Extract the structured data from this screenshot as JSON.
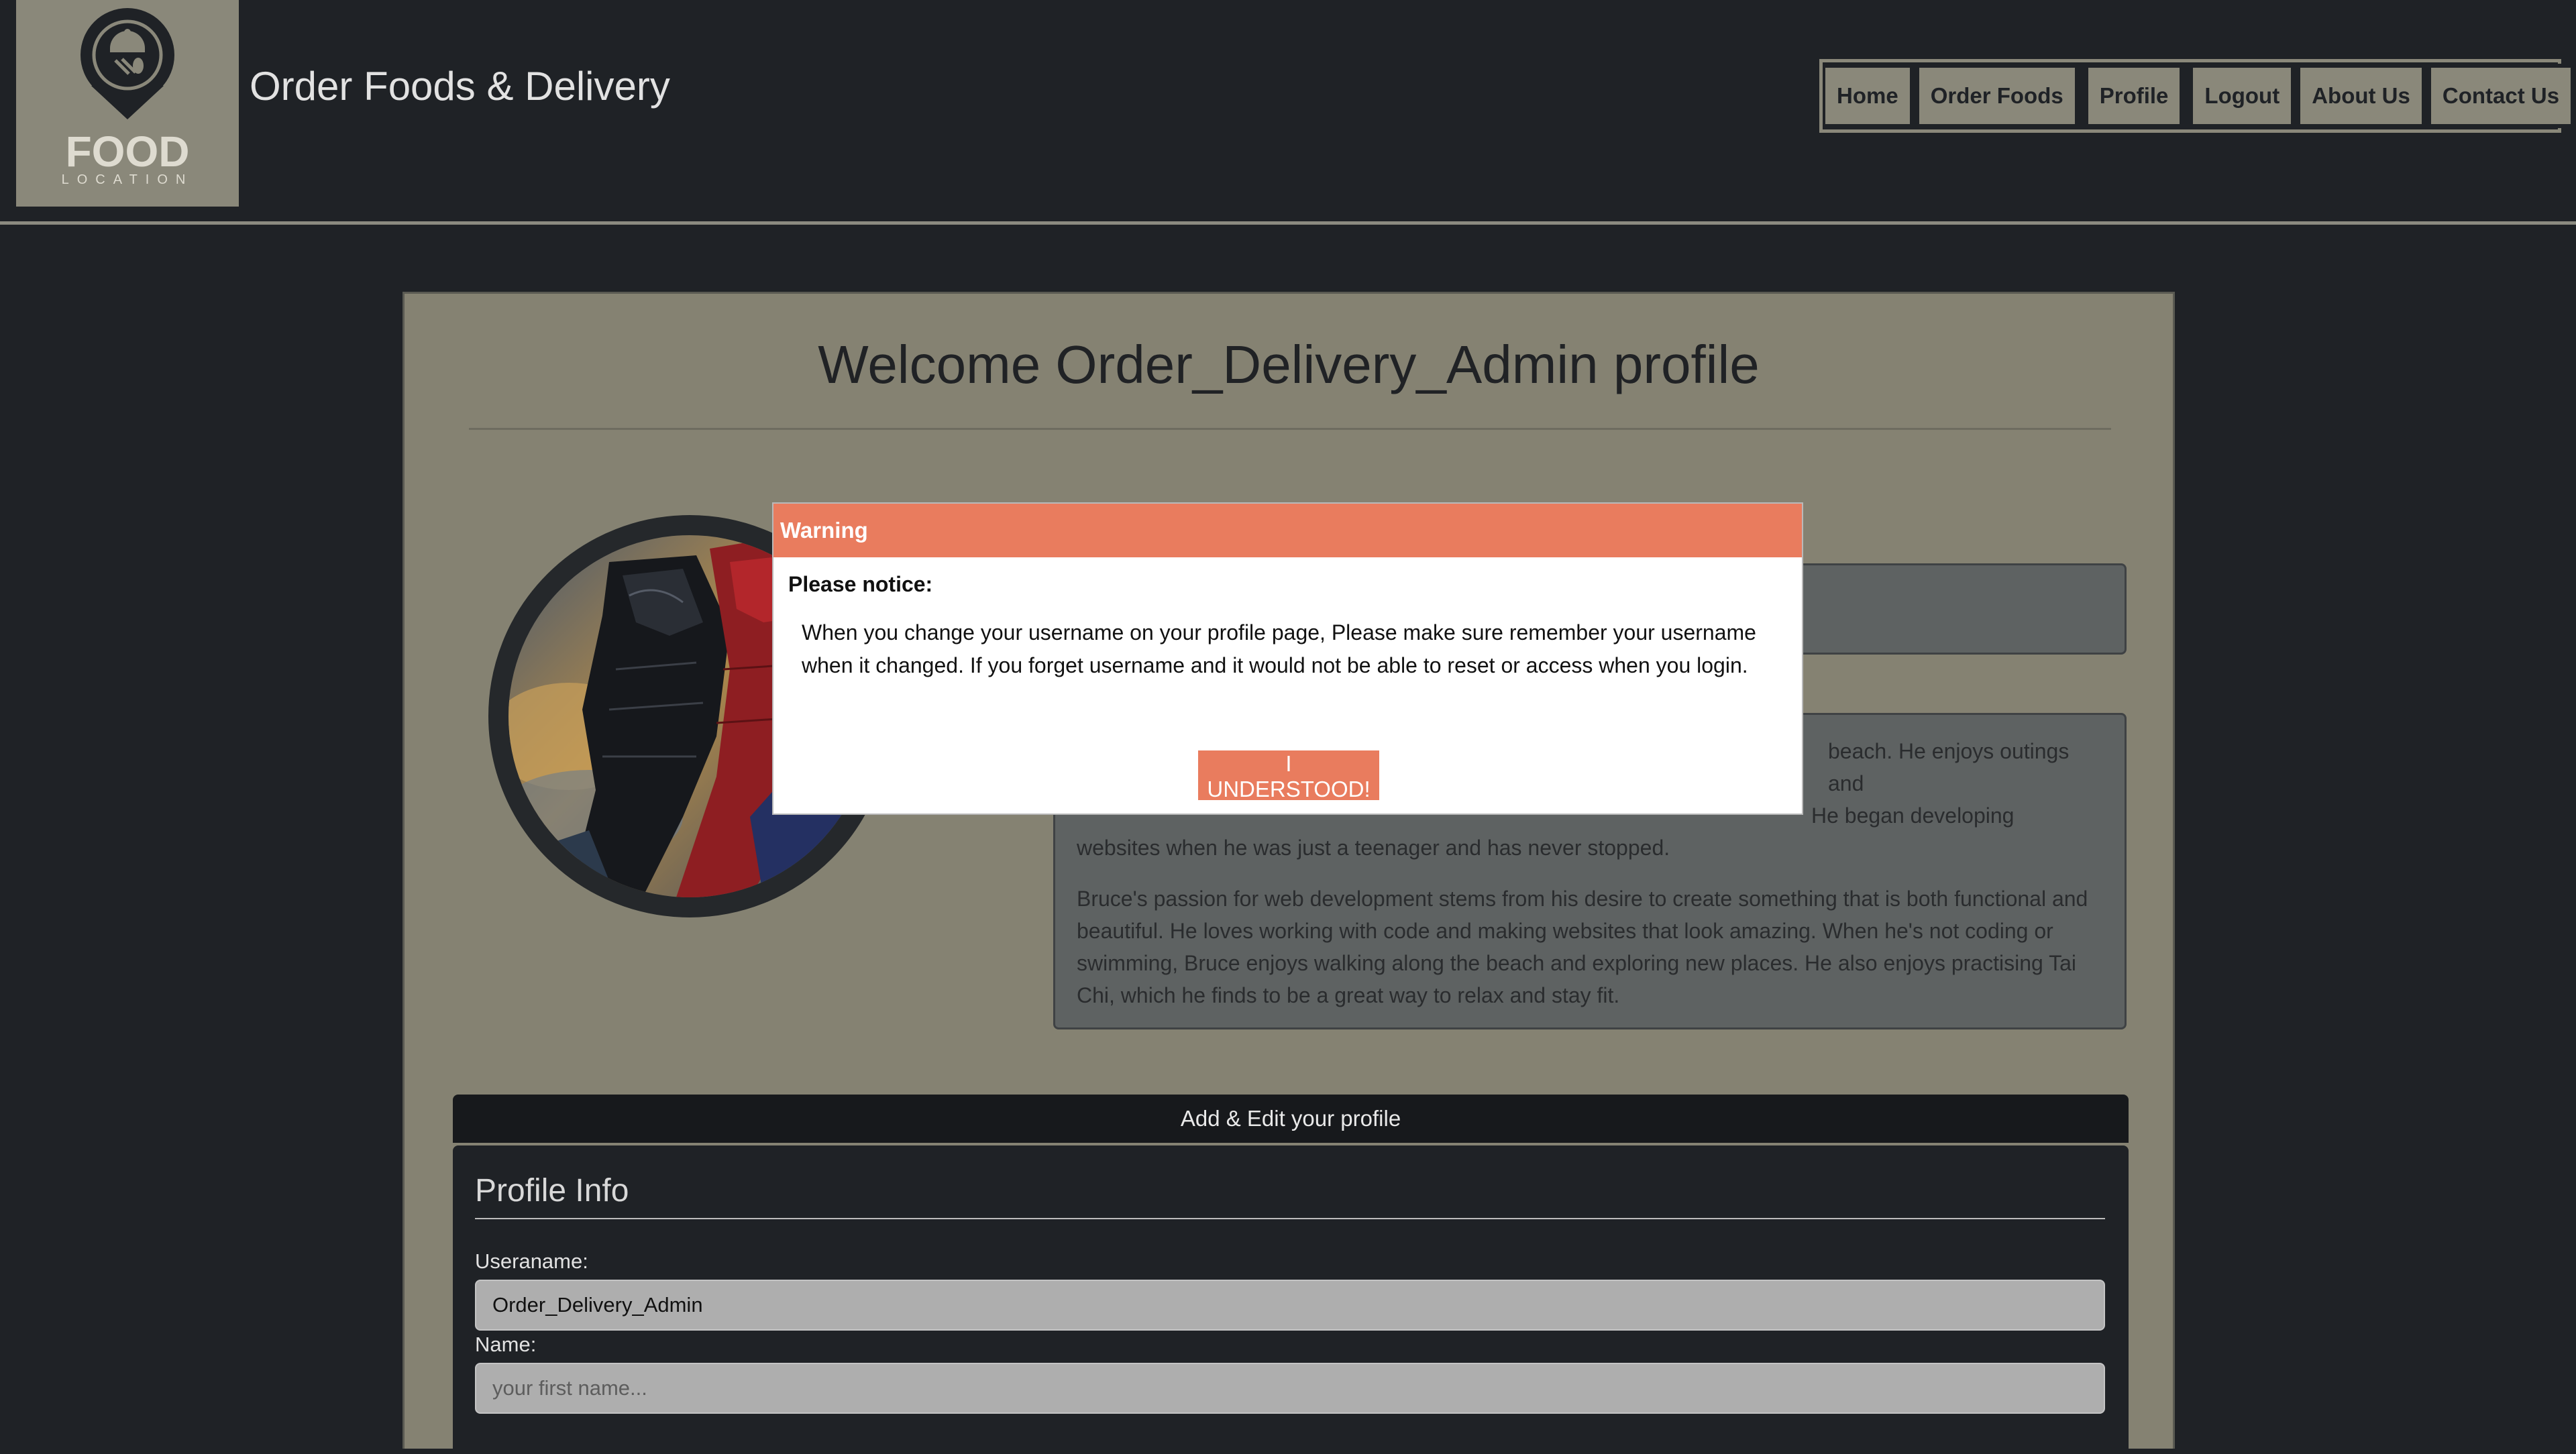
{
  "header": {
    "logo": {
      "main": "FOOD",
      "sub": "LOCATION"
    },
    "site_title": "Order Foods & Delivery",
    "nav": [
      "Home",
      "Order Foods",
      "Profile",
      "Logout",
      "About Us",
      "Contact Us"
    ],
    "active_nav": "Profile"
  },
  "profile": {
    "welcome": "Welcome Order_Delivery_Admin profile",
    "bio": {
      "p1_line1": "beach. He enjoys outings and",
      "p1_line2": "He began developing",
      "p1_line3": "websites when he was just a teenager and has never stopped.",
      "p2": "Bruce's passion for web development stems from his desire to create something that is both functional and beautiful. He loves working with code and making websites that look amazing. When he's not coding or swimming, Bruce enjoys walking along the beach and exploring new places. He also enjoys practising Tai Chi, which he finds to be a great way to relax and stay fit."
    }
  },
  "edit": {
    "header": "Add & Edit your profile",
    "section_title": "Profile Info",
    "username_label": "Useraname:",
    "username_value": "Order_Delivery_Admin",
    "name_label": "Name:",
    "name_placeholder": "your first name..."
  },
  "modal": {
    "title": "Warning",
    "notice": "Please notice:",
    "text": "When you change your username on your profile page, Please make sure remember your username when it changed. If you forget username and it would not be able to reset or access when you login.",
    "button": "I UNDERSTOOD!"
  },
  "colors": {
    "background": "#1f2226",
    "accent": "#e97c5e",
    "card": "#858272",
    "logo_bg": "#8a887a"
  }
}
